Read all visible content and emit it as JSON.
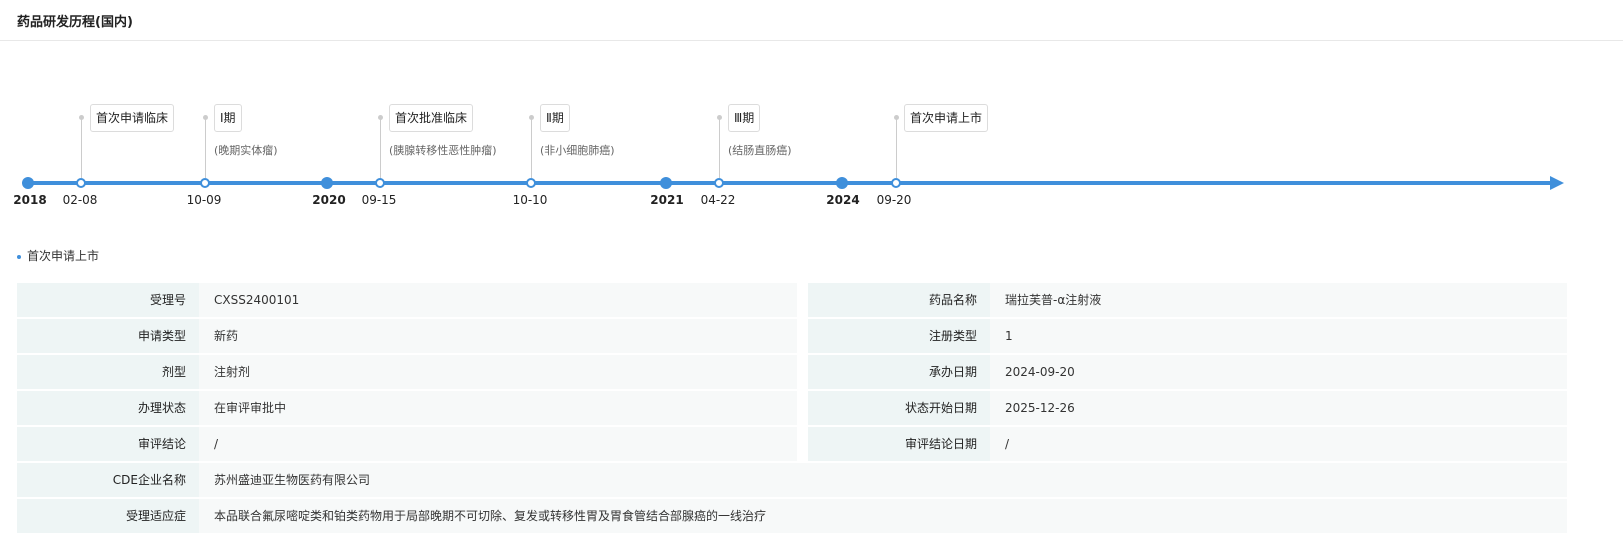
{
  "title": "药品研发历程(国内)",
  "timeline": {
    "years": [
      "2018",
      "2020",
      "2021",
      "2024"
    ],
    "events": [
      {
        "date": "02-08",
        "label": "首次申请临床",
        "sub": ""
      },
      {
        "date": "10-09",
        "label": "Ⅰ期",
        "sub": "(晚期实体瘤)"
      },
      {
        "date": "09-15",
        "label": "首次批准临床",
        "sub": "(胰腺转移性恶性肿瘤)"
      },
      {
        "date": "10-10",
        "label": "Ⅱ期",
        "sub": "(非小细胞肺癌)"
      },
      {
        "date": "04-22",
        "label": "Ⅲ期",
        "sub": "(结肠直肠癌)"
      },
      {
        "date": "09-20",
        "label": "首次申请上市",
        "sub": ""
      }
    ]
  },
  "section": "首次申请上市",
  "details": [
    {
      "l1": "受理号",
      "v1": "CXSS2400101",
      "l2": "药品名称",
      "v2": "瑞拉芙普-α注射液"
    },
    {
      "l1": "申请类型",
      "v1": "新药",
      "l2": "注册类型",
      "v2": "1"
    },
    {
      "l1": "剂型",
      "v1": "注射剂",
      "l2": "承办日期",
      "v2": "2024-09-20"
    },
    {
      "l1": "办理状态",
      "v1": "在审评审批中",
      "l2": "状态开始日期",
      "v2": "2025-12-26"
    },
    {
      "l1": "审评结论",
      "v1": "/",
      "l2": "审评结论日期",
      "v2": "/"
    },
    {
      "l1": "CDE企业名称",
      "v1": "苏州盛迪亚生物医药有限公司"
    },
    {
      "l1": "受理适应症",
      "v1": "本品联合氟尿嘧啶类和铂类药物用于局部晚期不可切除、复发或转移性胃及胃食管结合部腺癌的一线治疗"
    }
  ]
}
